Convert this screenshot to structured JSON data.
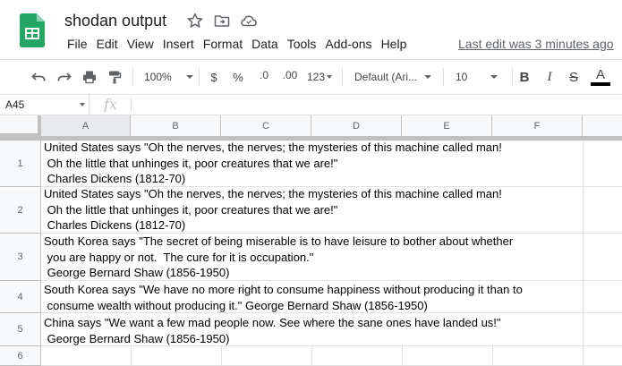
{
  "app": {
    "title": "shodan output",
    "last_edit": "Last edit was 3 minutes ago",
    "brand_color": "#0f9d58"
  },
  "menu": [
    "File",
    "Edit",
    "View",
    "Insert",
    "Format",
    "Data",
    "Tools",
    "Add-ons",
    "Help"
  ],
  "toolbar": {
    "zoom": "100%",
    "currency": "$",
    "percent": "%",
    "decrease_decimal": ".0",
    "increase_decimal": ".00",
    "more_formats": "123",
    "font": "Default (Ari...",
    "font_size": "10",
    "bold": "B",
    "italic": "I",
    "strike": "S",
    "text_color": "A"
  },
  "formula_bar": {
    "name_box": "A45",
    "fx": "fx",
    "value": ""
  },
  "columns": [
    "A",
    "B",
    "C",
    "D",
    "E",
    "F"
  ],
  "rows": [
    {
      "num": "1",
      "text": "United States says \"Oh the nerves, the nerves; the mysteries of this machine called man!\n Oh the little that unhinges it, poor creatures that we are!\"\n Charles Dickens (1812-70)"
    },
    {
      "num": "2",
      "text": "United States says \"Oh the nerves, the nerves; the mysteries of this machine called man!\n Oh the little that unhinges it, poor creatures that we are!\"\n Charles Dickens (1812-70)"
    },
    {
      "num": "3",
      "text": "South Korea says \"The secret of being miserable is to have leisure to bother about whether\n you are happy or not.  The cure for it is occupation.\"\n George Bernard Shaw (1856-1950)"
    },
    {
      "num": "4",
      "text": "South Korea says \"We have no more right to consume happiness without producing it than to\n consume wealth without producing it.\" George Bernard Shaw (1856-1950)"
    },
    {
      "num": "5",
      "text": "China says \"We want a few mad people now. See where the sane ones have landed us!\"\n George Bernard Shaw (1856-1950)"
    },
    {
      "num": "6",
      "text": ""
    }
  ]
}
